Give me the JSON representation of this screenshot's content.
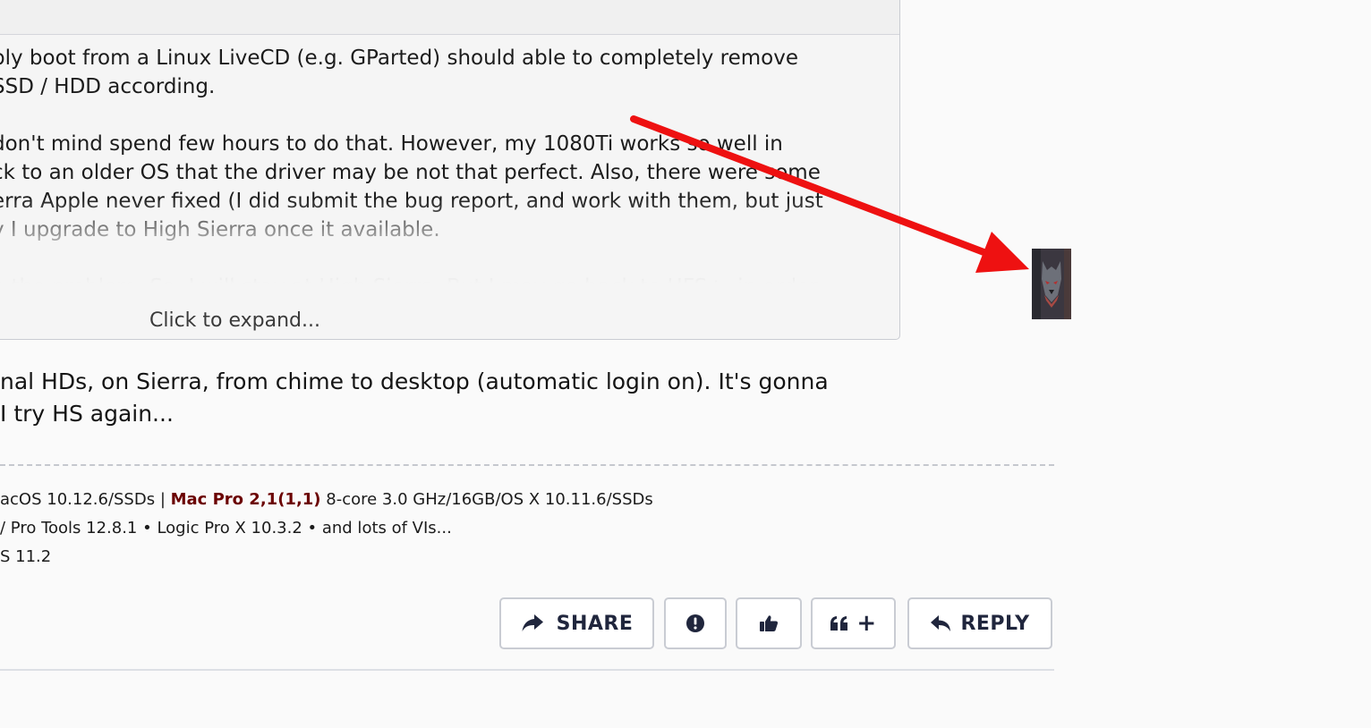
{
  "quote": {
    "lines": [
      "ply boot from a Linux LiveCD (e.g. GParted) should able to completely remove",
      "SSD / HDD according.",
      "don't mind spend few hours to do that. However, my 1080Ti works so well in",
      "ck to an older OS that the driver may be not that perfect. Also, there were some",
      "erra Apple never fixed (I did submit the bug report, and work with them, but just",
      "y I upgrade to High Sierra once it available.",
      "e the problem. So, I will stay at High Sierra. But I may go back to HFS+, in order"
    ],
    "expand_label": "Click to expand..."
  },
  "post": {
    "lines": [
      "nal HDs, on Sierra, from chime to desktop (automatic login on). It's gonna",
      " I try HS again..."
    ]
  },
  "signature": {
    "line1_prefix": "acOS 10.12.6/SSDs | ",
    "line1_strong": "Mac Pro 2,1(1,1)",
    "line1_suffix": " 8-core 3.0 GHz/16GB/OS X 10.11.6/SSDs",
    "line2": "/ Pro Tools 12.8.1 • Logic Pro X 10.3.2 • and lots of VIs...",
    "line3": "S 11.2"
  },
  "actions": {
    "share_label": "SHARE",
    "quote_plus_label": "+",
    "reply_label": "REPLY"
  },
  "icons": {
    "share": "share-icon",
    "report": "exclamation-circle-icon",
    "like": "thumbs-up-icon",
    "quote": "quote-icon",
    "reply": "reply-icon"
  },
  "colors": {
    "annotation_arrow": "#ee1111",
    "signature_highlight": "#6b0000",
    "button_text": "#20263d"
  }
}
